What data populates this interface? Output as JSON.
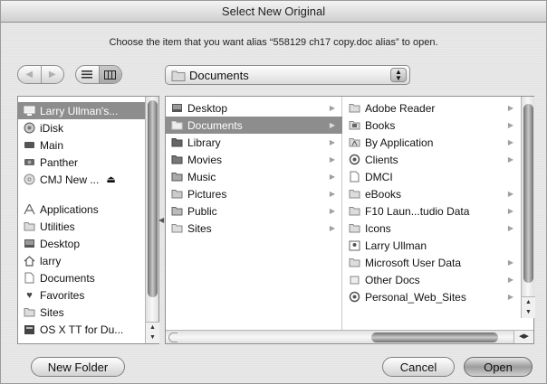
{
  "window": {
    "title": "Select New Original"
  },
  "prompt": "Choose the item that you want alias “558129 ch17 copy.doc alias” to open.",
  "toolbar": {
    "back_icon": "back-arrow-icon",
    "forward_icon": "forward-arrow-icon",
    "list_view_icon": "list-view-icon",
    "column_view_icon": "column-view-icon",
    "location": "Documents"
  },
  "sidebar": {
    "devices": [
      {
        "label": "Larry Ullman's...",
        "icon": "computer-icon",
        "selected": true
      },
      {
        "label": "iDisk",
        "icon": "idisk-icon"
      },
      {
        "label": "Main",
        "icon": "disk-icon"
      },
      {
        "label": "Panther",
        "icon": "disk-icon"
      },
      {
        "label": "CMJ New ...",
        "icon": "cd-icon",
        "eject": "⏏"
      }
    ],
    "places": [
      {
        "label": "Applications",
        "icon": "applications-icon"
      },
      {
        "label": "Utilities",
        "icon": "folder-icon"
      },
      {
        "label": "Desktop",
        "icon": "desktop-icon"
      },
      {
        "label": "larry",
        "icon": "home-icon"
      },
      {
        "label": "Documents",
        "icon": "document-icon"
      },
      {
        "label": "Favorites",
        "icon": "heart-icon"
      },
      {
        "label": "Sites",
        "icon": "folder-icon"
      },
      {
        "label": "OS X TT for Du...",
        "icon": "book-icon"
      }
    ]
  },
  "browser": {
    "column1": [
      {
        "label": "Desktop",
        "arrow": "▶"
      },
      {
        "label": "Documents",
        "arrow": "▶",
        "selected": true
      },
      {
        "label": "Library",
        "arrow": "▶"
      },
      {
        "label": "Movies",
        "arrow": "▶"
      },
      {
        "label": "Music",
        "arrow": "▶"
      },
      {
        "label": "Pictures",
        "arrow": "▶"
      },
      {
        "label": "Public",
        "arrow": "▶"
      },
      {
        "label": "Sites",
        "arrow": "▶"
      }
    ],
    "column2": [
      {
        "label": "Adobe Reader",
        "arrow": "▶"
      },
      {
        "label": "Books",
        "arrow": "▶"
      },
      {
        "label": "By Application",
        "arrow": "▶"
      },
      {
        "label": "Clients",
        "arrow": "▶"
      },
      {
        "label": "DMCI",
        "arrow": "▶"
      },
      {
        "label": "eBooks",
        "arrow": "▶"
      },
      {
        "label": "F10 Laun...tudio Data",
        "arrow": "▶"
      },
      {
        "label": "Icons",
        "arrow": "▶"
      },
      {
        "label": "Larry Ullman",
        "arrow": ""
      },
      {
        "label": "Microsoft User Data",
        "arrow": "▶"
      },
      {
        "label": "Other Docs",
        "arrow": "▶"
      },
      {
        "label": "Personal_Web_Sites",
        "arrow": "▶"
      }
    ]
  },
  "buttons": {
    "new_folder": "New Folder",
    "cancel": "Cancel",
    "open": "Open"
  }
}
